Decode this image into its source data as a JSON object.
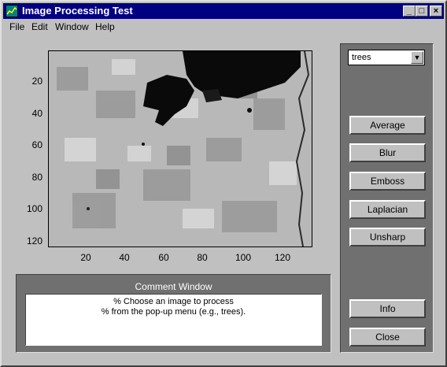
{
  "window": {
    "title": "Image Processing Test",
    "minimize_icon": "minimize-icon",
    "maximize_icon": "maximize-icon",
    "close_icon": "close-icon"
  },
  "menu": [
    "File",
    "Edit",
    "Window",
    "Help"
  ],
  "axes": {
    "y_ticks": [
      "20",
      "40",
      "60",
      "80",
      "100",
      "120"
    ],
    "x_ticks": [
      "20",
      "40",
      "60",
      "80",
      "100",
      "120"
    ]
  },
  "controls": {
    "popup_value": "trees",
    "buttons": [
      "Average",
      "Blur",
      "Emboss",
      "Laplacian",
      "Unsharp"
    ],
    "info_label": "Info",
    "close_label": "Close"
  },
  "comment": {
    "title": "Comment Window",
    "lines": [
      "% Choose an image to process",
      "% from the pop-up menu (e.g., trees)."
    ]
  }
}
